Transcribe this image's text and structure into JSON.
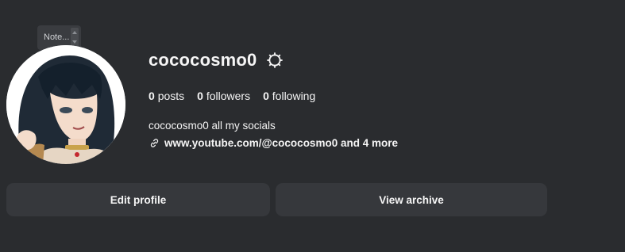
{
  "note": {
    "text": "Note..."
  },
  "profile": {
    "username": "cococosmo0",
    "stats": {
      "posts_count": "0",
      "posts_label": "posts",
      "followers_count": "0",
      "followers_label": "followers",
      "following_count": "0",
      "following_label": "following"
    },
    "bio": "cococosmo0 all my socials",
    "link_text": "www.youtube.com/@cococosmo0 and 4 more"
  },
  "buttons": {
    "edit_profile": "Edit profile",
    "view_archive": "View archive"
  },
  "icons": {
    "settings": "gear-icon",
    "link": "link-icon",
    "avatar": "avatar-image"
  },
  "colors": {
    "background": "#2a2c2f",
    "button_bg": "#36383c",
    "text": "#f5f5f5"
  }
}
